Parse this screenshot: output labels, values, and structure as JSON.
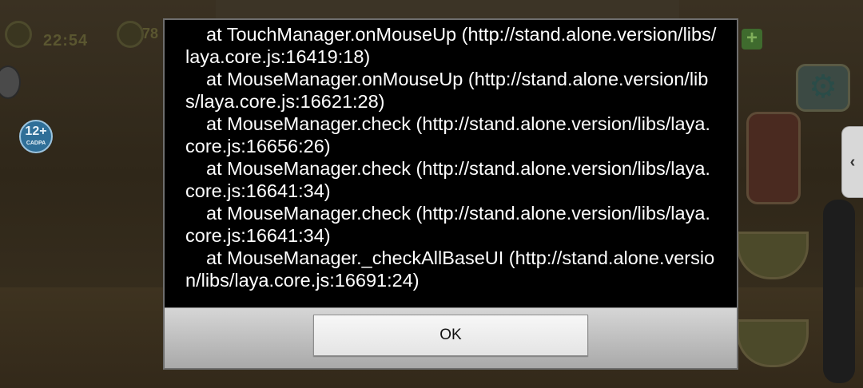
{
  "game": {
    "timer_text": "22:54",
    "score_text": "78",
    "age_rating": "12+",
    "age_rating_sub": "CADPA",
    "side_tab_glyph": "‹"
  },
  "dialog": {
    "trace_lines": [
      "at TouchManager.onMouseUp (http://stand.alone.version/libs/laya.core.js:16419:18)",
      "at MouseManager.onMouseUp (http://stand.alone.version/libs/laya.core.js:16621:28)",
      "at MouseManager.check (http://stand.alone.version/libs/laya.core.js:16656:26)",
      "at MouseManager.check (http://stand.alone.version/libs/laya.core.js:16641:34)",
      "at MouseManager.check (http://stand.alone.version/libs/laya.core.js:16641:34)",
      "at MouseManager._checkAllBaseUI (http://stand.alone.version/libs/laya.core.js:16691:24)"
    ],
    "ok_label": "OK"
  },
  "icons": {
    "clock": "clock-icon",
    "smile": "smile-icon",
    "chat": "chat-icon",
    "settings": "gear-icon",
    "add": "plus-icon",
    "side_tab": "chevron-left-icon"
  }
}
